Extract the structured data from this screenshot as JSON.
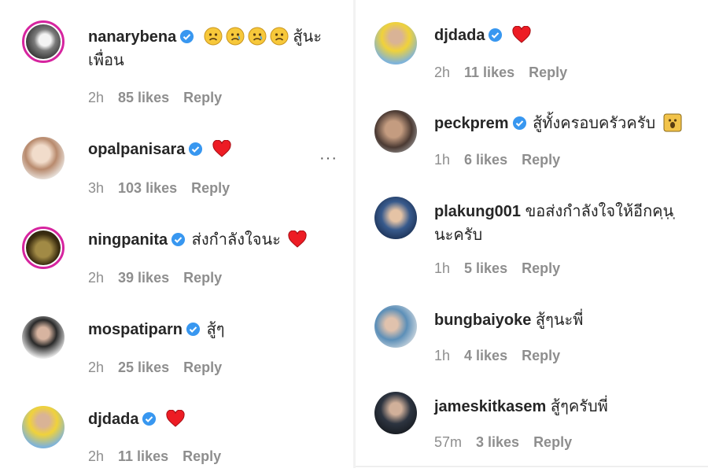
{
  "ui": {
    "verified_color": "#3897f0",
    "heart_color": "#ed1c24",
    "meta_color": "#8e8e8e",
    "text_color": "#262626",
    "more_label": "···"
  },
  "left_comments": [
    {
      "username": "nanarybena",
      "verified": true,
      "text_line1": "สู้นะ",
      "text_line2": "เพื่อน",
      "emoji": "sad-face-icon ×4",
      "time": "2h",
      "likes": "85 likes",
      "reply": "Reply"
    },
    {
      "username": "opalpanisara",
      "verified": true,
      "text_line1": "",
      "emoji": "heart-icon",
      "time": "3h",
      "likes": "103 likes",
      "reply": "Reply"
    },
    {
      "username": "ningpanita",
      "verified": true,
      "text_line1": "ส่งกำลังใจนะ",
      "emoji": "heart-icon",
      "time": "2h",
      "likes": "39 likes",
      "reply": "Reply"
    },
    {
      "username": "mospatiparn",
      "verified": true,
      "text_line1": "สู้ๆ",
      "time": "2h",
      "likes": "25 likes",
      "reply": "Reply"
    },
    {
      "username": "djdada",
      "verified": true,
      "text_line1": "",
      "emoji": "heart-icon",
      "time": "2h",
      "likes": "11 likes",
      "reply": "Reply"
    }
  ],
  "right_comments": [
    {
      "username": "djdada",
      "verified": true,
      "text_line1": "",
      "emoji": "heart-icon",
      "time": "2h",
      "likes": "11 likes",
      "reply": "Reply"
    },
    {
      "username": "peckprem",
      "verified": true,
      "text_line1": "สู้ทั้งครอบครัวครับ",
      "emoji": "screaming-face-icon",
      "time": "1h",
      "likes": "6 likes",
      "reply": "Reply"
    },
    {
      "username": "plakung001",
      "verified": false,
      "text_line1": "ขอส่งกำลังใจให้อีกคน",
      "text_line2": "นะครับ",
      "time": "1h",
      "likes": "5 likes",
      "reply": "Reply"
    },
    {
      "username": "bungbaiyoke",
      "verified": false,
      "text_line1": "สู้ๆนะพี่",
      "time": "1h",
      "likes": "4 likes",
      "reply": "Reply"
    },
    {
      "username": "jameskitkasem",
      "verified": false,
      "text_line1": "สู้ๆครับพี่",
      "time": "57m",
      "likes": "3 likes",
      "reply": "Reply"
    }
  ]
}
